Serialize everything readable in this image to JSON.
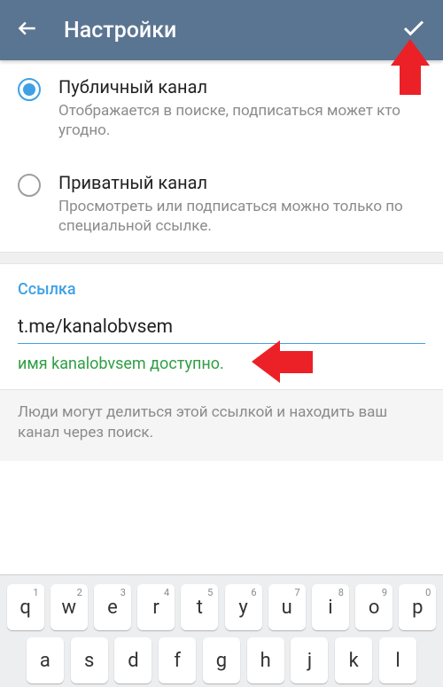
{
  "header": {
    "title": "Настройки"
  },
  "options": {
    "public": {
      "label": "Публичный канал",
      "desc": "Отображается в поиске, подписаться может кто угодно."
    },
    "private": {
      "label": "Приватный канал",
      "desc": "Просмотреть или подписаться можно только по специальной ссылке."
    }
  },
  "link": {
    "header": "Ссылка",
    "prefix": "t.me/",
    "value": "kanalobvsem",
    "availability": "имя kanalobvsem доступно.",
    "hint": "Люди могут делиться этой ссылкой и находить ваш канал через поиск."
  },
  "keyboard": {
    "row1": [
      {
        "k": "q",
        "n": "1"
      },
      {
        "k": "w",
        "n": "2"
      },
      {
        "k": "e",
        "n": "3"
      },
      {
        "k": "r",
        "n": "4"
      },
      {
        "k": "t",
        "n": "5"
      },
      {
        "k": "y",
        "n": "6"
      },
      {
        "k": "u",
        "n": "7"
      },
      {
        "k": "i",
        "n": "8"
      },
      {
        "k": "o",
        "n": "9"
      },
      {
        "k": "p",
        "n": "0"
      }
    ],
    "row2": [
      {
        "k": "a"
      },
      {
        "k": "s"
      },
      {
        "k": "d"
      },
      {
        "k": "f"
      },
      {
        "k": "g"
      },
      {
        "k": "h"
      },
      {
        "k": "j"
      },
      {
        "k": "k"
      },
      {
        "k": "l"
      }
    ]
  }
}
